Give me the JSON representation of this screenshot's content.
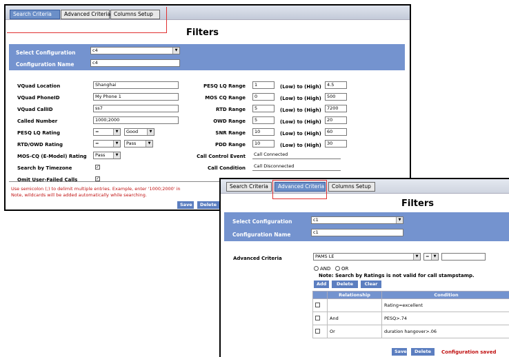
{
  "window1": {
    "tabs": [
      "Search Criteria",
      "Advanced Criteria",
      "Columns Setup"
    ],
    "title": "Filters",
    "select_configuration_label": "Select Configuration",
    "select_configuration_value": "c4",
    "configuration_name_label": "Configuration Name",
    "configuration_name_value": "c4",
    "left_fields": [
      {
        "label": "VQuad Location",
        "value": "Shanghai"
      },
      {
        "label": "VQuad PhoneID",
        "value": "My Phone 1"
      },
      {
        "label": "VQuad CallID",
        "value": "ss7"
      },
      {
        "label": "Called Number",
        "value": "1000;2000"
      },
      {
        "label": "PESQ LQ Rating",
        "op": "=",
        "rating": "Good"
      },
      {
        "label": "RTD/OWD Rating",
        "op": "=",
        "rating": "Pass"
      },
      {
        "label": "MOS-CQ (E-Model) Rating",
        "rating": "Pass"
      },
      {
        "label": "Search by Timezone"
      },
      {
        "label": "Omit User-Failed Calls"
      }
    ],
    "right_fields": [
      {
        "label": "PESQ LQ Range",
        "low": "1",
        "mid": "(Low) to (High)",
        "high": "4.5"
      },
      {
        "label": "MOS CQ Range",
        "low": "0",
        "mid": "(Low) to (High)",
        "high": "500"
      },
      {
        "label": "RTD Range",
        "low": "5",
        "mid": "(Low) to (High)",
        "high": "7200"
      },
      {
        "label": "OWD Range",
        "low": "5",
        "mid": "(Low) to (High)",
        "high": "20"
      },
      {
        "label": "SNR Range",
        "low": "10",
        "mid": "(Low) to (High)",
        "high": "60"
      },
      {
        "label": "PDD Range",
        "low": "10",
        "mid": "(Low) to (High)",
        "high": "30"
      },
      {
        "label": "Call Control Event",
        "value": "Call Connected"
      },
      {
        "label": "Call Condition",
        "value": "Call Disconnected"
      }
    ],
    "note_line1": "Use semicolon (;) to delimit multiple entries. Example, enter '1000;2000' in",
    "note_line2": "Note, wildcards will be added automatically while searching.",
    "save_label": "Save",
    "delete_label": "Delete"
  },
  "window2": {
    "tabs": [
      "Search Criteria",
      "Advanced Criteria",
      "Columns Setup"
    ],
    "title": "Filters",
    "select_configuration_label": "Select Configuration",
    "select_configuration_value": "c1",
    "configuration_name_label": "Configuration Name",
    "configuration_name_value": "c1",
    "advanced_criteria_label": "Advanced Criteria",
    "criteria_field": "PAMS LE",
    "criteria_op": "=",
    "criteria_value": "",
    "and_label": "AND",
    "or_label": "OR",
    "note": "Note: Search by Ratings is not valid for call stampstamp.",
    "add_label": "Add",
    "delete_label": "Delete",
    "clear_label": "Clear",
    "table_headers": [
      "Relationship",
      "Condition"
    ],
    "rows": [
      {
        "relationship": "",
        "condition": "Rating=excellent"
      },
      {
        "relationship": "And",
        "condition": "PESQ>.74"
      },
      {
        "relationship": "Or",
        "condition": "duration hangover>.06"
      }
    ],
    "save_label": "Save",
    "delete_btn_label": "Delete",
    "status": "Configuration saved"
  },
  "colors": {
    "accent": "#7493cf",
    "highlight": "#e03030",
    "status": "#c01010"
  }
}
